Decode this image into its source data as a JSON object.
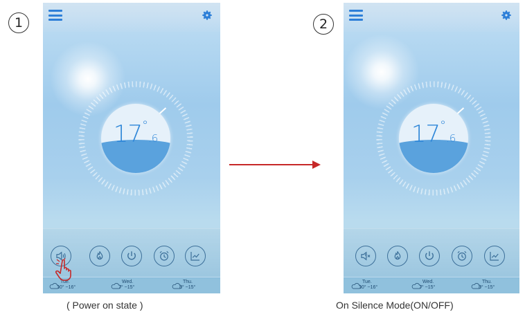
{
  "steps": [
    {
      "number": "1",
      "caption": "( Power on state )",
      "temperature": {
        "main": "17",
        "degree": "°",
        "decimal": ".6"
      },
      "buttons": [
        {
          "name": "silence",
          "icon": "speaker-icon"
        },
        {
          "name": "flame",
          "icon": "flame-icon"
        },
        {
          "name": "power",
          "icon": "power-icon"
        },
        {
          "name": "alarm",
          "icon": "alarm-clock-icon"
        },
        {
          "name": "chart",
          "icon": "chart-icon"
        }
      ],
      "forecast": [
        {
          "day": "Tue.",
          "range": "10° ~16°"
        },
        {
          "day": "Wed.",
          "range": "7° ~15°"
        },
        {
          "day": "Thu.",
          "range": "8° ~15°"
        }
      ]
    },
    {
      "number": "2",
      "caption": "On Silence Mode(ON/OFF)",
      "temperature": {
        "main": "17",
        "degree": "°",
        "decimal": ".6"
      },
      "buttons": [
        {
          "name": "silence",
          "icon": "speaker-muted-icon"
        },
        {
          "name": "flame",
          "icon": "flame-icon"
        },
        {
          "name": "power",
          "icon": "power-icon"
        },
        {
          "name": "alarm",
          "icon": "alarm-clock-icon"
        },
        {
          "name": "chart",
          "icon": "chart-icon"
        }
      ],
      "forecast": [
        {
          "day": "Tue.",
          "range": "10° ~16°"
        },
        {
          "day": "Wed.",
          "range": "7° ~15°"
        },
        {
          "day": "Thu.",
          "range": "8° ~15°"
        }
      ]
    }
  ],
  "colors": {
    "accent_blue": "#2d7fd8",
    "water": "#5aa2dd",
    "arrow": "#c62828",
    "hand": "#c62828"
  }
}
